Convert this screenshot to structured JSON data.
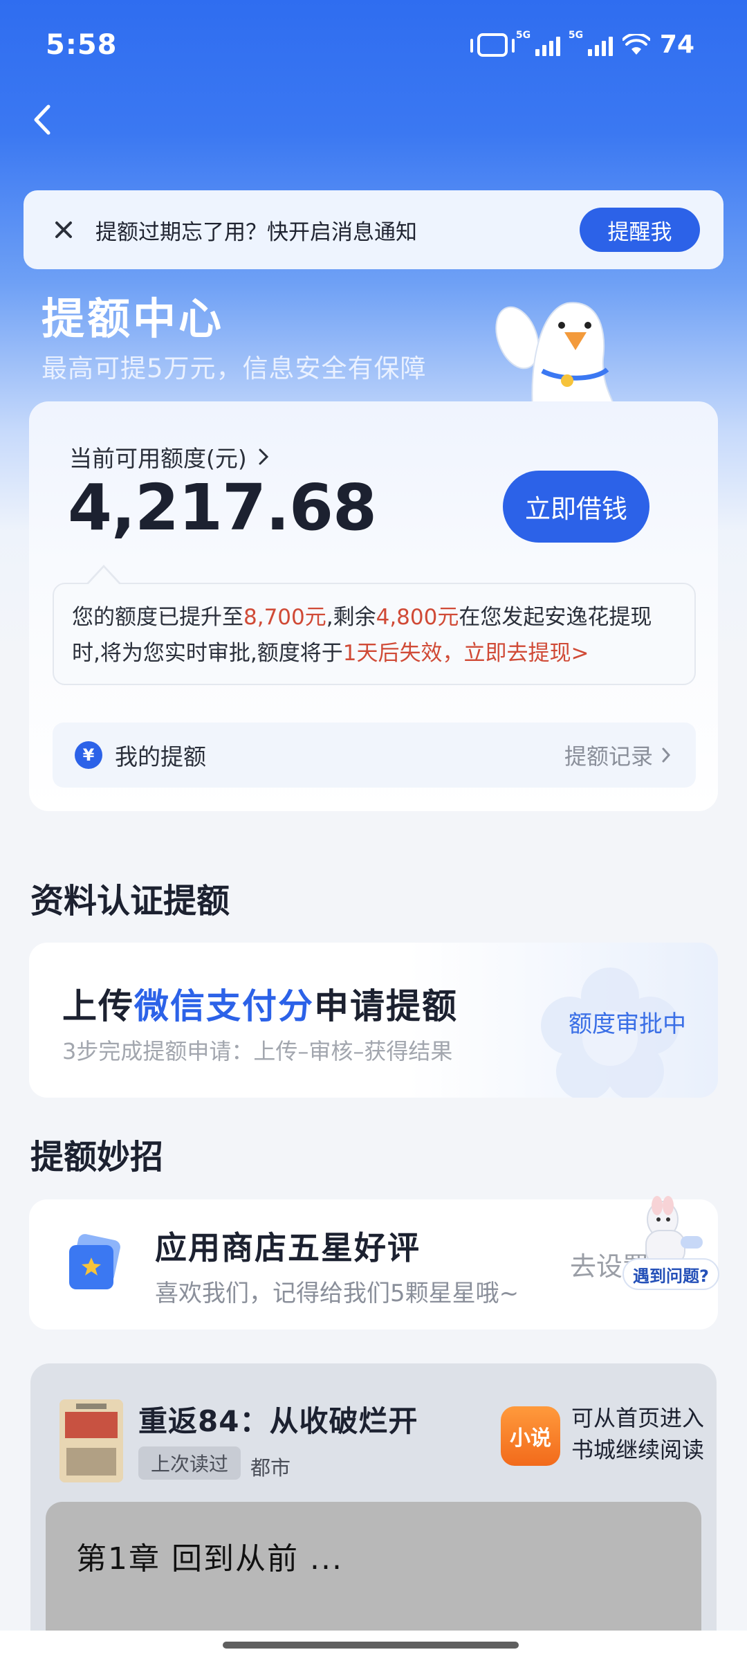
{
  "status_bar": {
    "time": "5:58",
    "battery": "74",
    "network_1": "5G",
    "network_2": "5G"
  },
  "notice": {
    "text": "提额过期忘了用？快开启消息通知",
    "button": "提醒我"
  },
  "hero": {
    "title": "提额中心",
    "subtitle": "最高可提5万元，信息安全有保障"
  },
  "credit": {
    "label": "当前可用额度(元)",
    "amount": "4,217.68",
    "borrow_button": "立即借钱",
    "tip_part1": "您的额度已提升至",
    "tip_amount1": "8,700元",
    "tip_part2": ",剩余",
    "tip_amount2": "4,800元",
    "tip_part3": "在您发起安逸花提现时,将为您实时审批,额度将于",
    "tip_expire": "1天后失效，立即去提现>",
    "my_limit_label": "我的提额",
    "my_limit_link": "提额记录",
    "yen_symbol": "¥"
  },
  "section_cert": {
    "title": "资料认证提额"
  },
  "upload": {
    "title_pre": "上传",
    "title_highlight": "微信支付分",
    "title_post": "申请提额",
    "subtitle": "3步完成提额申请：上传–审核–获得结果",
    "status": "额度审批中"
  },
  "section_tips": {
    "title": "提额妙招"
  },
  "star_tip": {
    "title": "应用商店五星好评",
    "subtitle": "喜欢我们，记得给我们5颗星星哦~",
    "action": "去设置",
    "help": "遇到问题?"
  },
  "novel": {
    "title": "重返84：从收破烂开",
    "last_read": "上次读过",
    "genre": "都市",
    "app_icon_text": "小说",
    "note_line1": "可从首页进入",
    "note_line2": "书城继续阅读",
    "chapter": "第1章 回到从前 ..."
  },
  "colors": {
    "primary": "#2c62e8",
    "highlight_red": "#d04a36",
    "header_blue": "#2f6df0"
  }
}
